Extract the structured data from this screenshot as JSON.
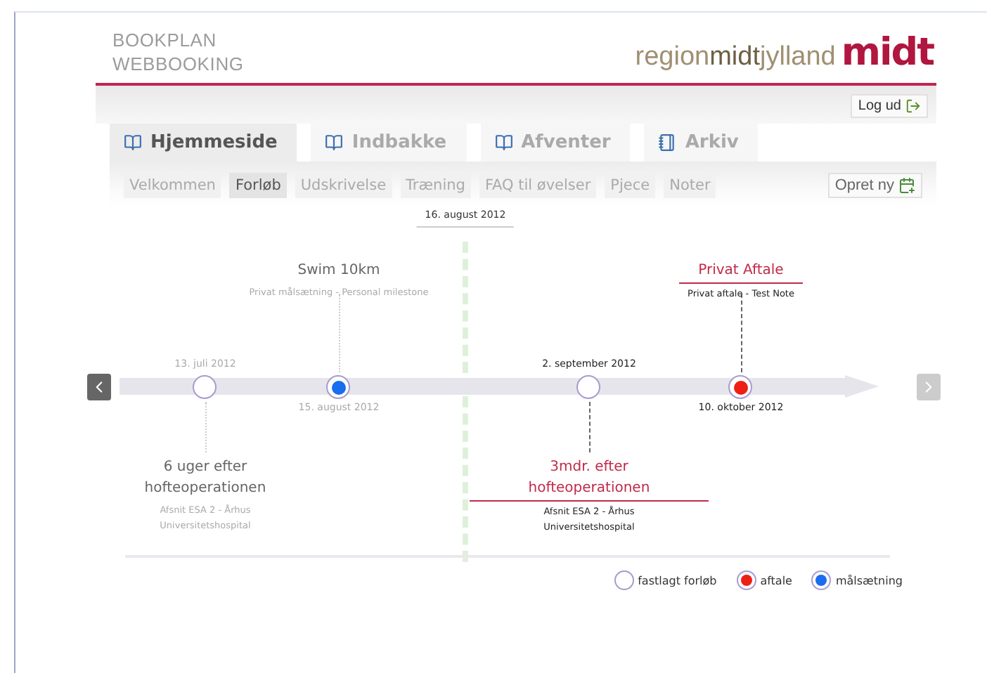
{
  "brand": {
    "lines": [
      "BOOKPLAN",
      "WEBBOOKING"
    ],
    "logo_text": "region**midt**jylland",
    "logo_mark": "midt"
  },
  "toolbar": {
    "logout": "Log ud"
  },
  "tabs": [
    {
      "label": "Hjemmeside",
      "selected": true
    },
    {
      "label": "Indbakke",
      "selected": false
    },
    {
      "label": "Afventer",
      "selected": false
    },
    {
      "label": "Arkiv",
      "selected": false
    }
  ],
  "subnav": [
    {
      "label": "Velkommen",
      "selected": false
    },
    {
      "label": "Forløb",
      "selected": true
    },
    {
      "label": "Udskrivelse",
      "selected": false
    },
    {
      "label": "Træning",
      "selected": false
    },
    {
      "label": "FAQ til øvelser",
      "selected": false
    },
    {
      "label": "Pjece",
      "selected": false
    },
    {
      "label": "Noter",
      "selected": false
    }
  ],
  "create_button": "Opret ny",
  "timeline": {
    "today": "16. august 2012",
    "events": [
      {
        "kind": "fixed",
        "past": true,
        "date": "13. juli 2012",
        "title": "6 uger efter hofteoperationen",
        "subtitle": "Afsnit ESA 2 - Århus Universitetshospital"
      },
      {
        "kind": "goal",
        "past": true,
        "date": "15. august 2012",
        "title": "Swim 10km",
        "subtitle": "Privat målsætning - Personal milestone"
      },
      {
        "kind": "fixed",
        "past": false,
        "date": "2. september 2012",
        "title": "3mdr. efter hofteoperationen",
        "subtitle": "Afsnit ESA 2 - Århus Universitetshospital"
      },
      {
        "kind": "appointment",
        "past": false,
        "date": "10. oktober 2012",
        "title": "Privat Aftale",
        "subtitle": "Privat aftale - Test Note"
      }
    ]
  },
  "legend": [
    {
      "kind": "fixed",
      "label": "fastlagt forløb"
    },
    {
      "kind": "appointment",
      "label": "aftale"
    },
    {
      "kind": "goal",
      "label": "målsætning"
    }
  ]
}
